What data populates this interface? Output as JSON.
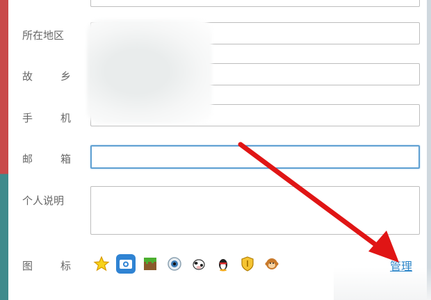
{
  "form": {
    "region_label": "所在地区",
    "hometown_label": [
      "故",
      "乡"
    ],
    "phone_label": [
      "手",
      "机"
    ],
    "email_label": [
      "邮",
      "箱"
    ],
    "bio_label": "个人说明",
    "icons_label": [
      "图",
      "标"
    ],
    "manage_link": "管理",
    "icons": [
      "star-icon",
      "camera-icon",
      "grass-block-icon",
      "eye-icon",
      "cow-icon",
      "penguin-icon",
      "shield-icon",
      "monkey-icon"
    ]
  },
  "colors": {
    "focus_border": "#5fa0d2",
    "arrow": "#e01515",
    "link": "#2d86c9"
  }
}
